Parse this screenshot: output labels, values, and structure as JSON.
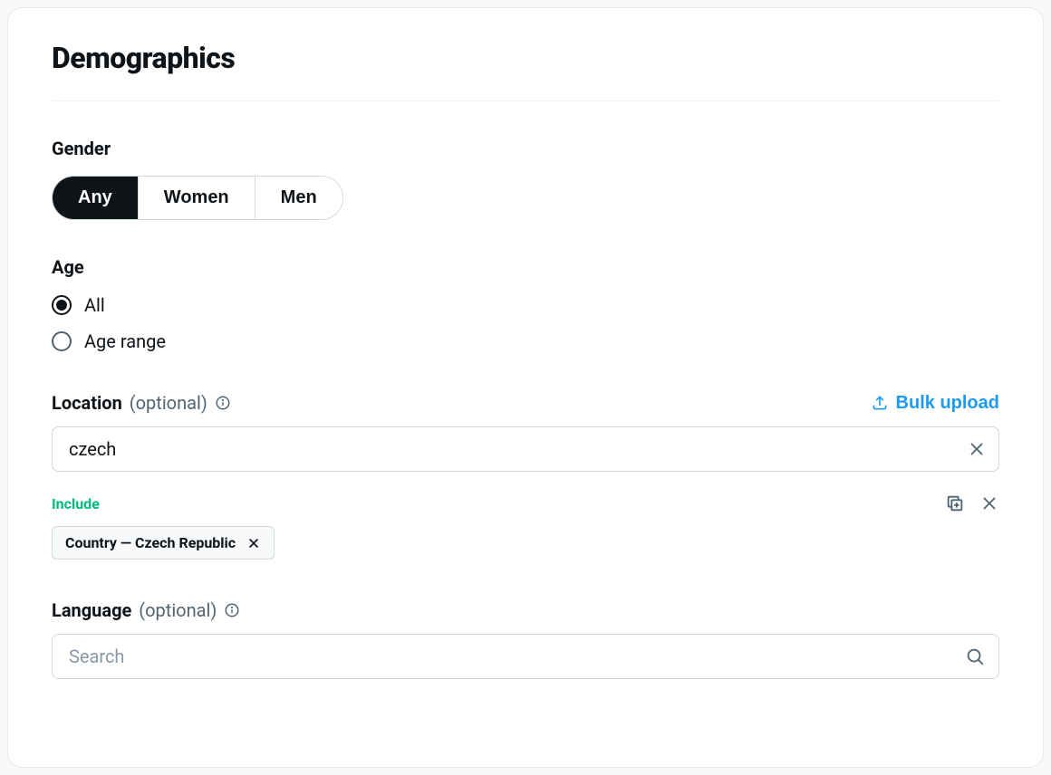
{
  "title": "Demographics",
  "gender": {
    "label": "Gender",
    "options": [
      "Any",
      "Women",
      "Men"
    ],
    "selected": "Any"
  },
  "age": {
    "label": "Age",
    "options": [
      "All",
      "Age range"
    ],
    "selected": "All"
  },
  "location": {
    "label": "Location",
    "optional_text": "(optional)",
    "bulk_upload_label": "Bulk upload",
    "input_value": "czech",
    "include_label": "Include",
    "chips": [
      {
        "text": "Country — Czech Republic"
      }
    ]
  },
  "language": {
    "label": "Language",
    "optional_text": "(optional)",
    "placeholder": "Search"
  },
  "colors": {
    "accent": "#1d9bf0",
    "success": "#00ba7c"
  }
}
